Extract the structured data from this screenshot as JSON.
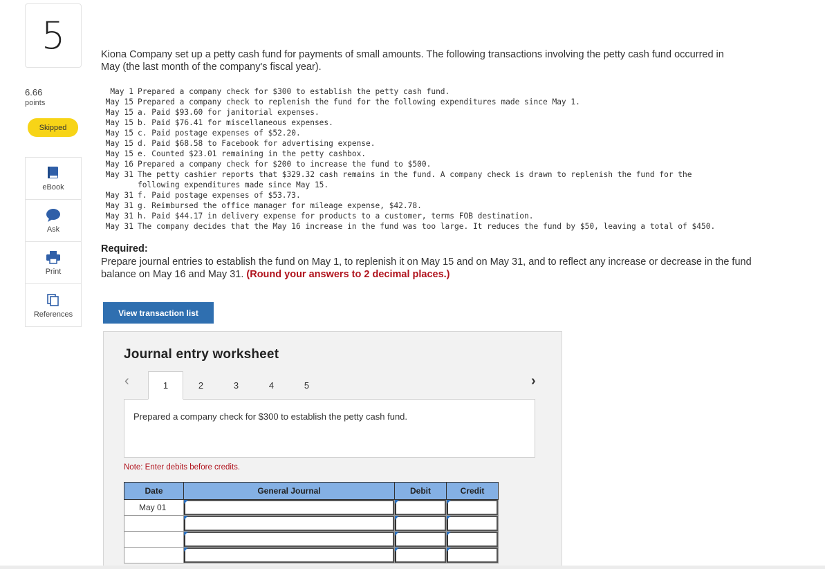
{
  "question": {
    "number": "5",
    "points_value": "6.66",
    "points_label": "points",
    "status": "Skipped"
  },
  "tools": [
    {
      "label": "eBook",
      "icon": "book-icon"
    },
    {
      "label": "Ask",
      "icon": "chat-bubble-icon"
    },
    {
      "label": "Print",
      "icon": "printer-icon"
    },
    {
      "label": "References",
      "icon": "copy-pages-icon"
    }
  ],
  "intro": "Kiona Company set up a petty cash fund for payments of small amounts. The following transactions involving the petty cash fund occurred in May (the last month of the company's fiscal year).",
  "transactions": [
    {
      "date": "May 1",
      "text": "Prepared a company check for $300 to establish the petty cash fund."
    },
    {
      "date": "May 15",
      "text": "Prepared a company check to replenish the fund for the following expenditures made since May 1."
    },
    {
      "date": "May 15",
      "text": "a. Paid $93.60 for janitorial expenses."
    },
    {
      "date": "May 15",
      "text": "b. Paid $76.41 for miscellaneous expenses."
    },
    {
      "date": "May 15",
      "text": "c. Paid postage expenses of $52.20."
    },
    {
      "date": "May 15",
      "text": "d. Paid $68.58 to Facebook for advertising expense."
    },
    {
      "date": "May 15",
      "text": "e. Counted $23.01 remaining in the petty cashbox."
    },
    {
      "date": "May 16",
      "text": "Prepared a company check for $200 to increase the fund to $500."
    },
    {
      "date": "May 31",
      "text": "The petty cashier reports that $329.32 cash remains in the fund. A company check is drawn to replenish the fund for the"
    },
    {
      "date": "",
      "text": "following expenditures made since May 15."
    },
    {
      "date": "May 31",
      "text": "f. Paid postage expenses of $53.73."
    },
    {
      "date": "May 31",
      "text": "g. Reimbursed the office manager for mileage expense, $42.78."
    },
    {
      "date": "May 31",
      "text": "h. Paid $44.17 in delivery expense for products to a customer, terms FOB destination."
    },
    {
      "date": "May 31",
      "text": "The company decides that the May 16 increase in the fund was too large. It reduces the fund by $50, leaving a total of $450."
    }
  ],
  "required": {
    "heading": "Required:",
    "text": "Prepare journal entries to establish the fund on May 1, to replenish it on May 15 and on May 31, and to reflect any increase or decrease in the fund balance on May 16 and May 31.",
    "emphasis": "(Round your answers to 2 decimal places.)"
  },
  "view_button": "View transaction list",
  "worksheet": {
    "title": "Journal entry worksheet",
    "tabs": [
      "1",
      "2",
      "3",
      "4",
      "5"
    ],
    "active_tab": "1",
    "description": "Prepared a company check for $300 to establish the petty cash fund.",
    "note": "Note: Enter debits before credits.",
    "columns": [
      "Date",
      "General Journal",
      "Debit",
      "Credit"
    ],
    "rows": [
      {
        "date": "May 01"
      },
      {
        "date": ""
      },
      {
        "date": ""
      },
      {
        "date": ""
      }
    ]
  },
  "colors": {
    "accent": "#2f6fb0",
    "skipped_badge": "#f7d417",
    "header_fill": "#84b0e4",
    "emphasis_red": "#b0131d"
  }
}
